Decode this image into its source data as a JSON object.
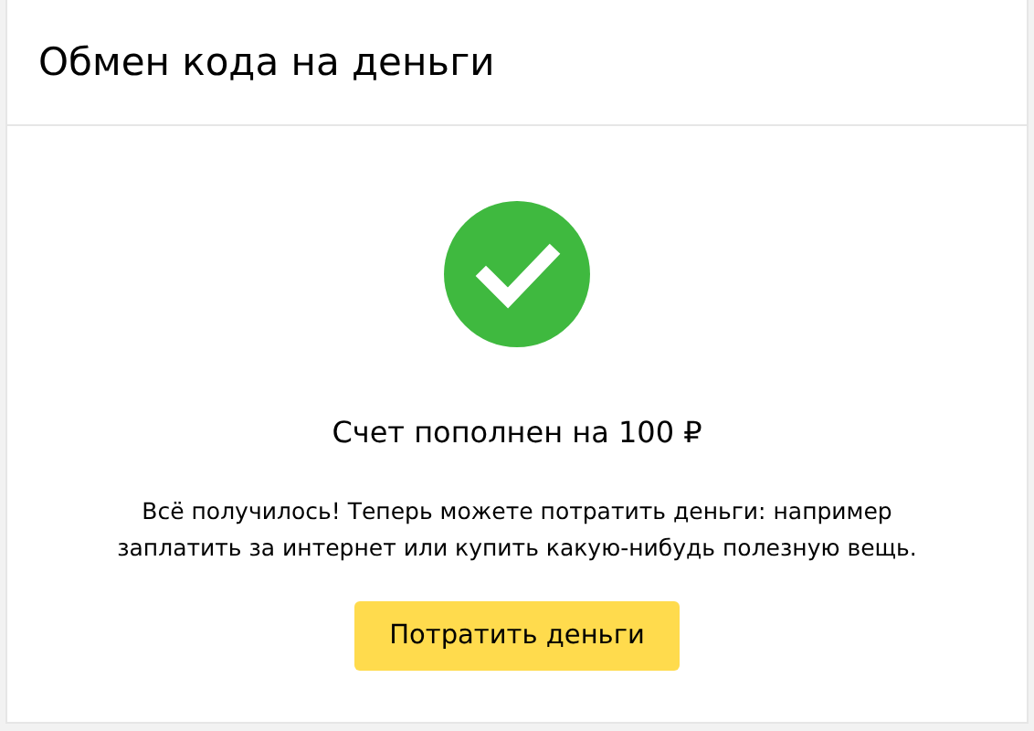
{
  "header": {
    "title": "Обмен кода на деньги"
  },
  "result": {
    "succeeded": true,
    "heading": "Счет пополнен на 100 ₽",
    "message": "Всё получилось! Теперь можете потратить деньги: например заплатить за интернет или купить какую-нибудь полезную вещь."
  },
  "buttons": [
    "Потратить деньги"
  ]
}
